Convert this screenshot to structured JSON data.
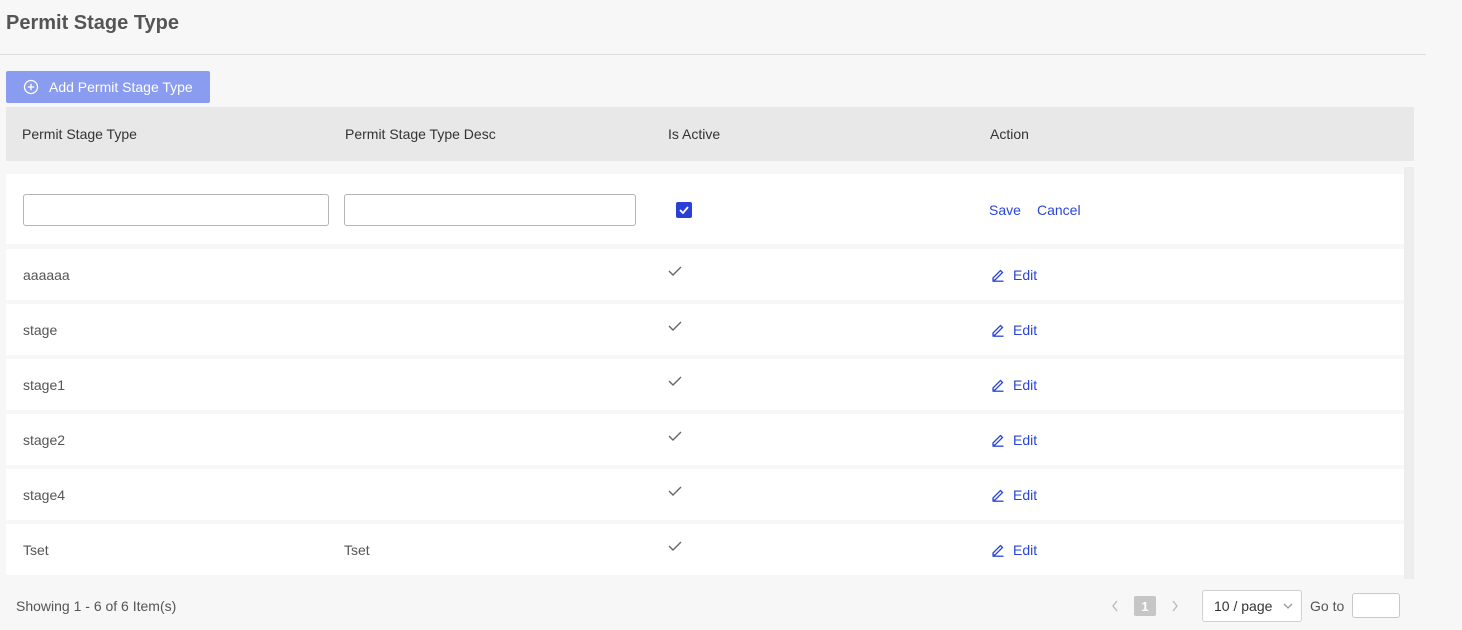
{
  "page": {
    "title": "Permit Stage Type"
  },
  "toolbar": {
    "add_label": "Add Permit Stage Type"
  },
  "table": {
    "columns": [
      "Permit Stage Type",
      "Permit Stage Type Desc",
      "Is Active",
      "Action"
    ],
    "edit_row": {
      "type_value": "",
      "desc_value": "",
      "is_active": true,
      "save_label": "Save",
      "cancel_label": "Cancel"
    },
    "rows": [
      {
        "type": "aaaaaa",
        "desc": "",
        "is_active": true,
        "action": "Edit"
      },
      {
        "type": "stage",
        "desc": "",
        "is_active": true,
        "action": "Edit"
      },
      {
        "type": "stage1",
        "desc": "",
        "is_active": true,
        "action": "Edit"
      },
      {
        "type": "stage2",
        "desc": "",
        "is_active": true,
        "action": "Edit"
      },
      {
        "type": "stage4",
        "desc": "",
        "is_active": true,
        "action": "Edit"
      },
      {
        "type": "Tset",
        "desc": "Tset",
        "is_active": true,
        "action": "Edit"
      }
    ]
  },
  "footer": {
    "showing": "Showing 1 - 6 of 6 Item(s)",
    "current_page": "1",
    "page_size": "10 / page",
    "goto_label": "Go to",
    "goto_value": ""
  },
  "colors": {
    "accent": "#2a45d6",
    "add_button": "#8a9cf0",
    "header_bg": "#e8e8e8"
  }
}
